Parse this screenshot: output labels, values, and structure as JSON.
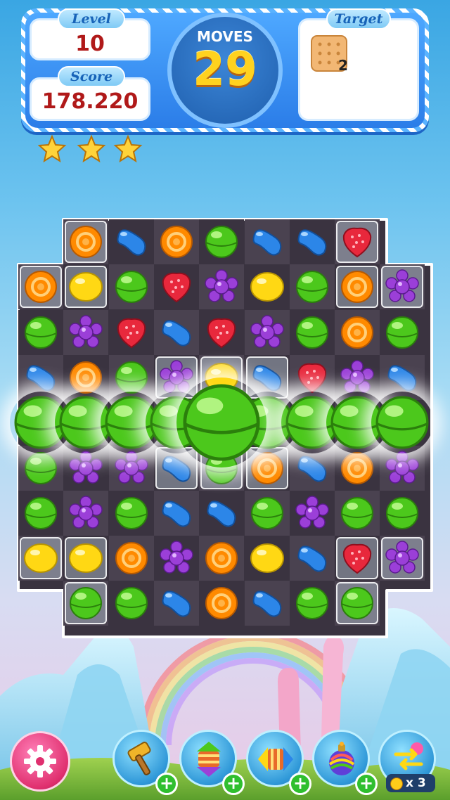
{
  "hud": {
    "level_label": "Level",
    "level_value": "10",
    "score_label": "Score",
    "score_value": "178.220",
    "moves_label": "MOVES",
    "moves_value": "29",
    "target_label": "Target",
    "target_item_icon": "biscuit-icon",
    "target_item_count": "2",
    "stars_earned": 3,
    "stars_total": 3
  },
  "board": {
    "rows": [
      [
        "",
        "orange",
        "blue",
        "orange",
        "green",
        "blue",
        "blue",
        "red",
        ""
      ],
      [
        "orange",
        "yellow",
        "green",
        "red",
        "purple",
        "yellow",
        "green",
        "orange",
        "purple"
      ],
      [
        "green",
        "purple",
        "red",
        "blue",
        "red",
        "purple",
        "green",
        "orange",
        "green"
      ],
      [
        "blue",
        "orange",
        "green",
        "purple",
        "yellow",
        "blue",
        "red",
        "purple",
        "blue"
      ],
      [
        "green",
        "green",
        "green",
        "green",
        "green",
        "green",
        "green",
        "green",
        "green"
      ],
      [
        "green",
        "purple",
        "purple",
        "blue",
        "green",
        "orange",
        "blue",
        "orange",
        "purple"
      ],
      [
        "green",
        "purple",
        "green",
        "blue",
        "blue",
        "green",
        "purple",
        "green",
        "green"
      ],
      [
        "yellow",
        "yellow",
        "orange",
        "purple",
        "orange",
        "yellow",
        "blue",
        "red",
        "purple"
      ],
      [
        "",
        "green",
        "green",
        "blue",
        "orange",
        "blue",
        "green",
        "green",
        ""
      ]
    ],
    "highlighted_match": "row 5 green lollipops"
  },
  "controls": {
    "settings_icon": "gear-icon",
    "boosters": [
      {
        "icon": "hammer-icon",
        "action": "add"
      },
      {
        "icon": "vertical-striped-candy-icon",
        "action": "add"
      },
      {
        "icon": "horizontal-striped-candy-icon",
        "action": "add"
      },
      {
        "icon": "color-bomb-icon",
        "action": "add"
      },
      {
        "icon": "swap-icon",
        "count": "x 3"
      }
    ]
  },
  "colors": {
    "green": "#4cc81c",
    "orange": "#ff8a00",
    "blue": "#2c86e8",
    "red": "#e8283c",
    "purple": "#9b3fd8",
    "yellow": "#ffd814",
    "hud_blue": "#2b7de8",
    "score_red": "#b01919",
    "moves_yellow": "#ffd21f"
  }
}
